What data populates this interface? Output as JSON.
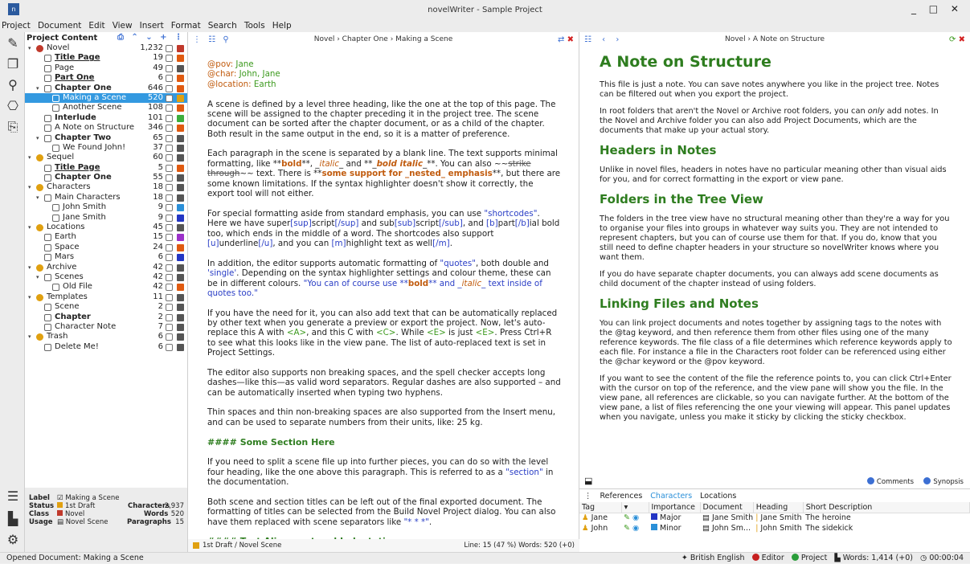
{
  "window": {
    "title": "novelWriter - Sample Project",
    "controls": "_ □ ✕"
  },
  "menu": [
    "Project",
    "Document",
    "Edit",
    "View",
    "Insert",
    "Format",
    "Search",
    "Tools",
    "Help"
  ],
  "tree": {
    "header": "Project Content",
    "header_icons": "⎙ ⌃ ⌄ + ⋮",
    "rows": [
      {
        "label": "Novel",
        "count": "1,232",
        "color": "#c0392b",
        "lvl": 0,
        "arrow": "▾",
        "folder": true,
        "bold": false
      },
      {
        "label": "Title Page",
        "count": "19",
        "color": "#e05a10",
        "lvl": 1,
        "bold": true,
        "ul": true
      },
      {
        "label": "Page",
        "count": "49",
        "color": "#555",
        "lvl": 1
      },
      {
        "label": "Part One",
        "count": "6",
        "color": "#e05a10",
        "lvl": 1,
        "bold": true,
        "ul": true
      },
      {
        "label": "Chapter One",
        "count": "646",
        "color": "#e05a10",
        "lvl": 1,
        "arrow": "▾",
        "bold": true
      },
      {
        "label": "Making a Scene",
        "count": "520",
        "color": "#e0a010",
        "lvl": 2,
        "sel": true
      },
      {
        "label": "Another Scene",
        "count": "108",
        "color": "#e05a10",
        "lvl": 2
      },
      {
        "label": "Interlude",
        "count": "101",
        "color": "#3cae3c",
        "lvl": 1,
        "bold": true
      },
      {
        "label": "A Note on Structure",
        "count": "346",
        "color": "#e05a10",
        "lvl": 1
      },
      {
        "label": "Chapter Two",
        "count": "65",
        "color": "#555",
        "lvl": 1,
        "arrow": "▾",
        "bold": true
      },
      {
        "label": "We Found John!",
        "count": "37",
        "color": "#555",
        "lvl": 2
      },
      {
        "label": "Sequel",
        "count": "60",
        "color": "#555",
        "lvl": 0,
        "arrow": "▾",
        "folder": true
      },
      {
        "label": "Title Page",
        "count": "5",
        "color": "#e05a10",
        "lvl": 1,
        "bold": true,
        "ul": true
      },
      {
        "label": "Chapter One",
        "count": "55",
        "color": "#555",
        "lvl": 1,
        "bold": true
      },
      {
        "label": "Characters",
        "count": "18",
        "color": "#555",
        "lvl": 0,
        "arrow": "▾",
        "folder": true
      },
      {
        "label": "Main Characters",
        "count": "18",
        "color": "#555",
        "lvl": 1,
        "arrow": "▾"
      },
      {
        "label": "John Smith",
        "count": "9",
        "color": "#2a8fd8",
        "lvl": 2
      },
      {
        "label": "Jane Smith",
        "count": "9",
        "color": "#2335c4",
        "lvl": 2
      },
      {
        "label": "Locations",
        "count": "45",
        "color": "#555",
        "lvl": 0,
        "arrow": "▾",
        "folder": true
      },
      {
        "label": "Earth",
        "count": "15",
        "color": "#9b2fc9",
        "lvl": 1
      },
      {
        "label": "Space",
        "count": "24",
        "color": "#e05a10",
        "lvl": 1
      },
      {
        "label": "Mars",
        "count": "6",
        "color": "#2335c4",
        "lvl": 1
      },
      {
        "label": "Archive",
        "count": "42",
        "color": "#555",
        "lvl": 0,
        "arrow": "▾",
        "folder": true
      },
      {
        "label": "Scenes",
        "count": "42",
        "color": "#555",
        "lvl": 1,
        "arrow": "▾"
      },
      {
        "label": "Old File",
        "count": "42",
        "color": "#e05a10",
        "lvl": 2
      },
      {
        "label": "Templates",
        "count": "11",
        "color": "#555",
        "lvl": 0,
        "arrow": "▾",
        "folder": true
      },
      {
        "label": "Scene",
        "count": "2",
        "color": "#555",
        "lvl": 1
      },
      {
        "label": "Chapter",
        "count": "2",
        "color": "#555",
        "lvl": 1,
        "bold": true
      },
      {
        "label": "Character Note",
        "count": "7",
        "color": "#555",
        "lvl": 1
      },
      {
        "label": "Trash",
        "count": "6",
        "color": "#555",
        "lvl": 0,
        "arrow": "▾",
        "folder": true
      },
      {
        "label": "Delete Me!",
        "count": "6",
        "color": "#555",
        "lvl": 1
      }
    ]
  },
  "details": {
    "label_key": "Label",
    "label_val": "Making a Scene",
    "status_key": "Status",
    "status_val": "1st Draft",
    "class_key": "Class",
    "class_val": "Novel",
    "usage_key": "Usage",
    "usage_val": "Novel Scene",
    "chars_key": "Characters",
    "chars_val": "2,937",
    "words_key": "Words",
    "words_val": "520",
    "para_key": "Paragraphs",
    "para_val": "15"
  },
  "editor": {
    "path": "Novel › Chapter One › Making a Scene",
    "footer_left": "1st Draft / Novel Scene",
    "footer_right": "Line: 15 (47 %)   Words: 520 (+0)"
  },
  "viewer": {
    "path": "Novel › A Note on Structure",
    "title": "A Note on Structure",
    "p1": "This file is just a note. You can save notes anywhere you like in the project tree. Notes can be filtered out when you export the project.",
    "p2a": "In root folders that aren't the Novel or Archive root folders, you can ",
    "p2b": "only",
    "p2c": " add notes. In the Novel and Archive folder you can also add Project Documents, which are the documents that make up your actual story.",
    "h_headers": "Headers in Notes",
    "p3": "Unlike in novel files, headers in notes have no particular meaning other than visual aids for you, and for correct formatting in the export or view pane.",
    "h_folders": "Folders in the Tree View",
    "p4": "The folders in the tree view have no structural meaning other than they're a way for you to organise your files into groups in whatever way suits you. They are not intended to represent chapters, but you can of course use them for that. If you do, know that you still need to define chapter headers in your structure so novelWriter knows where you want them.",
    "p5": "If you do have separate chapter documents, you can always add scene documents as child document of the chapter instead of using folders.",
    "h_linking": "Linking Files and Notes",
    "p6": "You can link project documents and notes together by assigning tags to the notes with the @tag keyword, and then reference them from other files using one of the many reference keywords. The file class of a file determines which reference keywords apply to each file. For instance a file in the Characters root folder can be referenced using either the @char keyword or the @pov keyword.",
    "p7": "If you want to see the content of the file the reference points to, you can click Ctrl+Enter with the cursor on top of the reference, and the view pane will show you the file. In the view pane, all references are clickable, so you can navigate further. At the bottom of the view pane, a list of files referencing the one your viewing will appear. This panel updates when you navigate, unless you make it sticky by clicking the sticky checkbox.",
    "comments": "Comments",
    "synopsis": "Synopsis"
  },
  "refs": {
    "tabs": [
      "References",
      "Characters",
      "Locations"
    ],
    "columns": [
      "Tag",
      "Importance",
      "Document",
      "Heading",
      "Short Description"
    ],
    "rows": [
      {
        "tag": "Jane",
        "importance": "Major",
        "color": "#2335c4",
        "document": "Jane Smith",
        "heading": "Jane Smith",
        "desc": "The heroine"
      },
      {
        "tag": "John",
        "importance": "Minor",
        "color": "#2a8fd8",
        "document": "John Sm...",
        "heading": "John Smith",
        "desc": "The sidekick"
      }
    ]
  },
  "status": {
    "left": "Opened Document: Making a Scene",
    "lang": "British English",
    "editor": "Editor",
    "project": "Project",
    "words": "Words: 1,414 (+0)",
    "time": "00:00:04"
  },
  "colors": {
    "accent": "#3c6fd3",
    "heading": "#2e7d1f",
    "selection": "#3399e0"
  }
}
